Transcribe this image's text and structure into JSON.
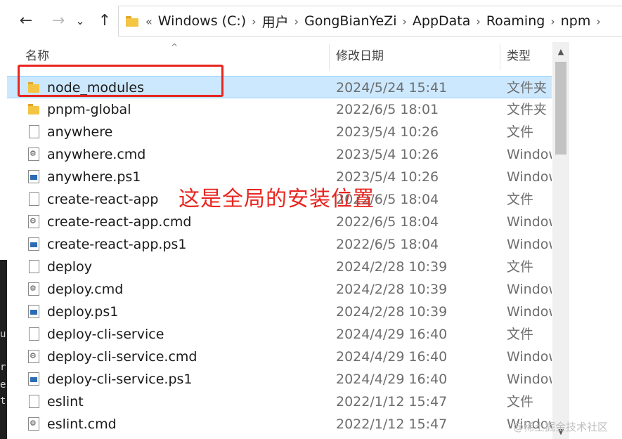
{
  "nav": {
    "back": "←",
    "forward": "→",
    "recent": "⌄",
    "up": "↑"
  },
  "breadcrumbs": {
    "overflow": "«",
    "items": [
      "Windows (C:)",
      "用户",
      "GongBianYeZi",
      "AppData",
      "Roaming",
      "npm"
    ],
    "separator": "›"
  },
  "columns": {
    "name": "名称",
    "date": "修改日期",
    "type": "类型"
  },
  "files": [
    {
      "name": "node_modules",
      "date": "2024/5/24 15:41",
      "type": "文件夹",
      "icon": "folder-icon",
      "selected": true
    },
    {
      "name": "pnpm-global",
      "date": "2022/6/5 18:01",
      "type": "文件夹",
      "icon": "folder-icon"
    },
    {
      "name": "anywhere",
      "date": "2023/5/4 10:26",
      "type": "文件",
      "icon": "file-icon"
    },
    {
      "name": "anywhere.cmd",
      "date": "2023/5/4 10:26",
      "type": "Window",
      "icon": "cmd-file-icon"
    },
    {
      "name": "anywhere.ps1",
      "date": "2023/5/4 10:26",
      "type": "Window",
      "icon": "powershell-file-icon"
    },
    {
      "name": "create-react-app",
      "date": "2022/6/5 18:04",
      "type": "文件",
      "icon": "file-icon"
    },
    {
      "name": "create-react-app.cmd",
      "date": "2022/6/5 18:04",
      "type": "Window",
      "icon": "cmd-file-icon"
    },
    {
      "name": "create-react-app.ps1",
      "date": "2022/6/5 18:04",
      "type": "Window",
      "icon": "powershell-file-icon"
    },
    {
      "name": "deploy",
      "date": "2024/2/28 10:39",
      "type": "文件",
      "icon": "file-icon"
    },
    {
      "name": "deploy.cmd",
      "date": "2024/2/28 10:39",
      "type": "Window",
      "icon": "cmd-file-icon"
    },
    {
      "name": "deploy.ps1",
      "date": "2024/2/28 10:39",
      "type": "Window",
      "icon": "powershell-file-icon"
    },
    {
      "name": "deploy-cli-service",
      "date": "2024/4/29 16:40",
      "type": "文件",
      "icon": "file-icon"
    },
    {
      "name": "deploy-cli-service.cmd",
      "date": "2024/4/29 16:40",
      "type": "Window",
      "icon": "cmd-file-icon"
    },
    {
      "name": "deploy-cli-service.ps1",
      "date": "2024/4/29 16:40",
      "type": "Window",
      "icon": "powershell-file-icon"
    },
    {
      "name": "eslint",
      "date": "2022/1/12 15:47",
      "type": "文件",
      "icon": "file-icon"
    },
    {
      "name": "eslint.cmd",
      "date": "2022/1/12 15:47",
      "type": "Window",
      "icon": "cmd-file-icon"
    }
  ],
  "annotation": "这是全局的安装位置",
  "watermark": "@稀土掘金技术社区",
  "terminal_chars": [
    "u",
    "r",
    "e",
    "t"
  ],
  "colors": {
    "highlight_red": "#e8251f",
    "selection": "#cce8ff",
    "folder": "#f4c543"
  }
}
